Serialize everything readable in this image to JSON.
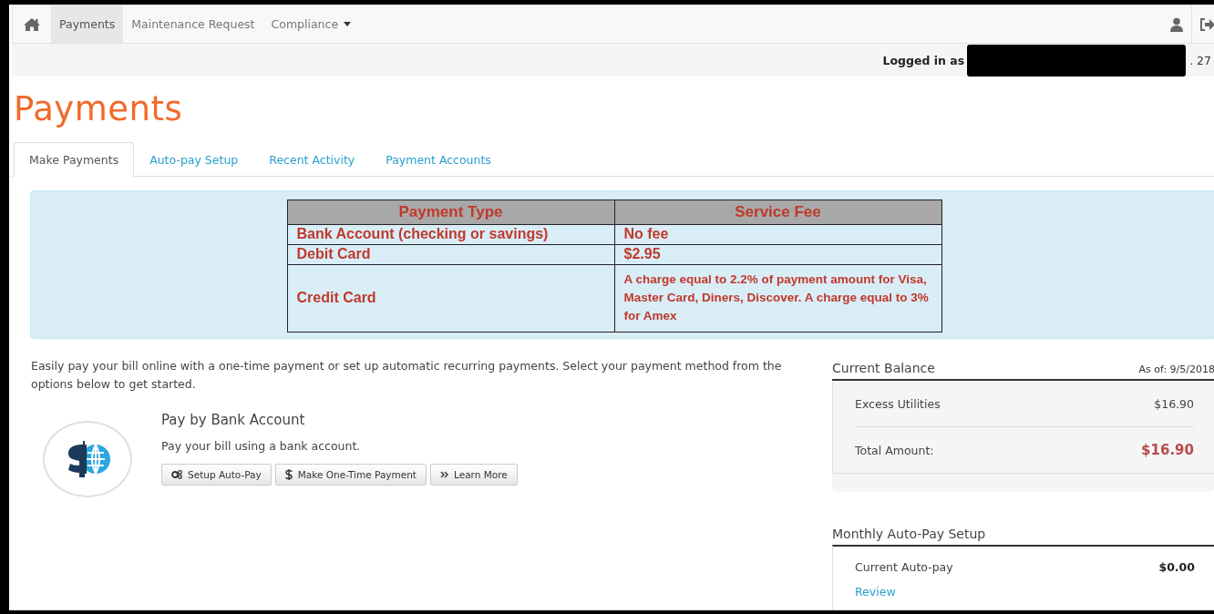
{
  "navbar": {
    "items": [
      {
        "label": "Payments",
        "selected": true
      },
      {
        "label": "Maintenance Request",
        "selected": false
      },
      {
        "label": "Compliance",
        "selected": false,
        "dropdown": true
      }
    ]
  },
  "login": {
    "label": "Logged in as",
    "trailing": ". 27"
  },
  "page_title": "Payments",
  "tabs": [
    {
      "label": "Make Payments",
      "selected": true
    },
    {
      "label": "Auto-pay Setup",
      "selected": false
    },
    {
      "label": "Recent Activity",
      "selected": false
    },
    {
      "label": "Payment Accounts",
      "selected": false
    }
  ],
  "fee_table": {
    "columns": [
      "Payment Type",
      "Service Fee"
    ],
    "rows": [
      [
        "Bank Account (checking or savings)",
        "No fee"
      ],
      [
        "Debit Card",
        "$2.95"
      ],
      [
        "Credit Card",
        "A charge equal to 2.2% of payment amount for Visa, Master Card, Diners, Discover. A charge equal to 3% for Amex"
      ]
    ]
  },
  "intro": "Easily pay your bill online with a one-time payment or set up automatic recurring payments. Select your payment method from the options below to get started.",
  "payment_method": {
    "title": "Pay by Bank Account",
    "description": "Pay your bill using a bank account.",
    "buttons": [
      {
        "label": "Setup Auto-Pay",
        "kind": "gears"
      },
      {
        "label": "Make One-Time Payment",
        "kind": "dollar"
      },
      {
        "label": "Learn More",
        "kind": "chevrons"
      }
    ]
  },
  "balance": {
    "title": "Current Balance",
    "as_of": "As of: 9/5/2018",
    "items": [
      {
        "label": "Excess Utilities",
        "amount": "$16.90"
      }
    ],
    "total": {
      "label": "Total Amount:",
      "amount": "$16.90"
    }
  },
  "autopay": {
    "title": "Monthly Auto-Pay Setup",
    "label": "Current Auto-pay",
    "amount": "$0.00",
    "link": "Review"
  }
}
